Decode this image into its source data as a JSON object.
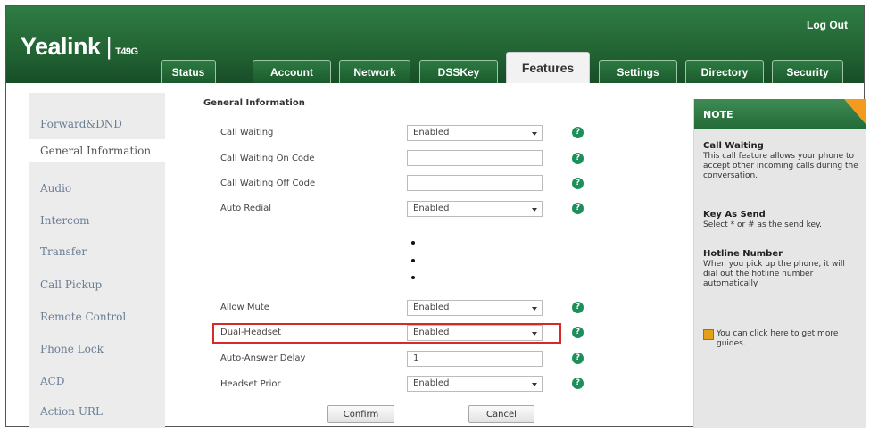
{
  "header": {
    "brand": "Yealink",
    "model": "T49G",
    "logout": "Log Out",
    "tabs": [
      "Status",
      "Account",
      "Network",
      "DSSKey",
      "Features",
      "Settings",
      "Directory",
      "Security"
    ],
    "active_tab": "Features"
  },
  "sidebar": {
    "items": [
      "Forward&DND",
      "General Information",
      "Audio",
      "Intercom",
      "Transfer",
      "Call Pickup",
      "Remote Control",
      "Phone Lock",
      "ACD",
      "Action URL"
    ],
    "active": "General Information"
  },
  "main": {
    "section_title": "General Information",
    "rows": [
      {
        "label": "Call Waiting",
        "value": "Enabled",
        "type": "select"
      },
      {
        "label": "Call Waiting On Code",
        "value": "",
        "type": "text"
      },
      {
        "label": "Call Waiting Off Code",
        "value": "",
        "type": "text"
      },
      {
        "label": "Auto Redial",
        "value": "Enabled",
        "type": "select"
      },
      {
        "label": "Allow Mute",
        "value": "Enabled",
        "type": "select"
      },
      {
        "label": "Dual-Headset",
        "value": "Enabled",
        "type": "select"
      },
      {
        "label": "Auto-Answer Delay",
        "value": "1",
        "type": "text"
      },
      {
        "label": "Headset Prior",
        "value": "Enabled",
        "type": "select"
      }
    ],
    "help_glyph": "?",
    "confirm_label": "Confirm",
    "cancel_label": "Cancel"
  },
  "note": {
    "title": "NOTE",
    "items": [
      {
        "heading": "Call Waiting",
        "text": "This call feature allows your phone to accept other incoming calls during the conversation."
      },
      {
        "heading": "Key As Send",
        "text": "Select * or # as the send key."
      },
      {
        "heading": "Hotline Number",
        "text": "When you pick up the phone, it will dial out the hotline number automatically."
      }
    ],
    "guide_text": "You can click here to get more guides."
  },
  "colors": {
    "header_green": "#1f5e30",
    "accent_orange": "#f39a1f",
    "highlight_red": "#d42a2a",
    "help_green": "#1d8f5a"
  }
}
